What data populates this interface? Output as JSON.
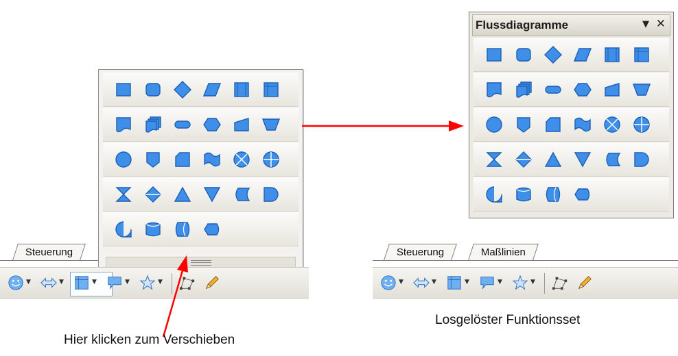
{
  "dropdown": {
    "rows": [
      [
        "process",
        "alternate-process",
        "decision",
        "data",
        "predefined-process",
        "internal-storage"
      ],
      [
        "document",
        "multidocument",
        "terminator",
        "preparation",
        "manual-input",
        "manual-operation"
      ],
      [
        "connector",
        "off-page-connector",
        "card",
        "punched-tape",
        "summing-junction",
        "or"
      ],
      [
        "collate",
        "sort",
        "extract",
        "merge",
        "stored-data",
        "delay"
      ],
      [
        "sequential-access",
        "magnetic-disk",
        "direct-access-storage",
        "display"
      ]
    ]
  },
  "floating": {
    "title": "Flussdiagramme",
    "menu_glyph": "▼",
    "close_glyph": "✕"
  },
  "left_tabs": [
    "Steuerung"
  ],
  "right_tabs": [
    "Steuerung",
    "Maßlinien"
  ],
  "captions": {
    "left": "Hier klicken zum Verschieben",
    "right": "Losgelöster Funktionsset"
  },
  "colors": {
    "shape_fill": "#3f8fe8",
    "shape_stroke": "#1c5fb5",
    "arrow": "#ff0000"
  },
  "toolbar_icons": [
    "smiley-icon",
    "double-arrow-icon",
    "flowchart-icon",
    "callout-icon",
    "star-icon",
    "curve-points-icon",
    "pencil-icon"
  ]
}
